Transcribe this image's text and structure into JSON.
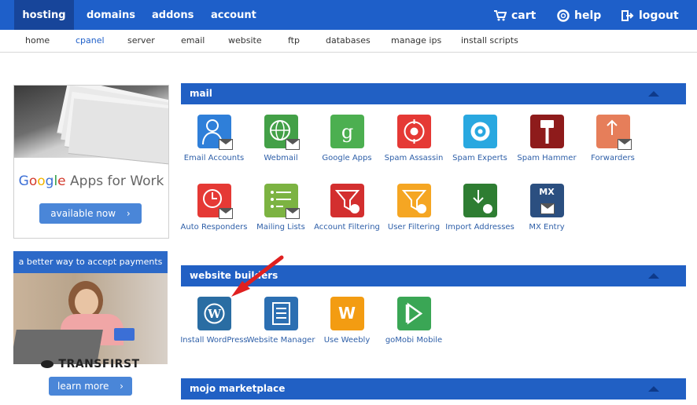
{
  "topnav": {
    "tabs": [
      {
        "label": "hosting"
      },
      {
        "label": "domains"
      },
      {
        "label": "addons"
      },
      {
        "label": "account"
      }
    ],
    "right": {
      "cart": "cart",
      "help": "help",
      "logout": "logout"
    }
  },
  "subnav": {
    "items": [
      {
        "label": "home"
      },
      {
        "label": "cpanel"
      },
      {
        "label": "server"
      },
      {
        "label": "email"
      },
      {
        "label": "website"
      },
      {
        "label": "ftp"
      },
      {
        "label": "databases"
      },
      {
        "label": "manage ips"
      },
      {
        "label": "install scripts"
      }
    ],
    "active": "cpanel"
  },
  "ads": {
    "google": {
      "brand_google": "Google",
      "brand_rest": "Apps for Work",
      "button": "available now"
    },
    "transfirst": {
      "header": "a better way to accept payments",
      "logo": "TRANSFIRST",
      "button": "learn more"
    }
  },
  "sections": {
    "mail": {
      "title": "mail",
      "apps": [
        {
          "label": "Email Accounts",
          "icon": "email-accounts-icon",
          "color": "#2f7fd9"
        },
        {
          "label": "Webmail",
          "icon": "webmail-icon",
          "color": "#43a047"
        },
        {
          "label": "Google Apps",
          "icon": "google-apps-icon",
          "color": "#4caf50"
        },
        {
          "label": "Spam Assassin",
          "icon": "spam-assassin-icon",
          "color": "#e53935"
        },
        {
          "label": "Spam Experts",
          "icon": "spam-experts-icon",
          "color": "#29a8e0"
        },
        {
          "label": "Spam Hammer",
          "icon": "spam-hammer-icon",
          "color": "#8e1b1b"
        },
        {
          "label": "Forwarders",
          "icon": "forwarders-icon",
          "color": "#e67e5a"
        },
        {
          "label": "Auto Responders",
          "icon": "auto-responders-icon",
          "color": "#e53935"
        },
        {
          "label": "Mailing Lists",
          "icon": "mailing-lists-icon",
          "color": "#7cb342"
        },
        {
          "label": "Account Filtering",
          "icon": "account-filtering-icon",
          "color": "#d32f2f"
        },
        {
          "label": "User Filtering",
          "icon": "user-filtering-icon",
          "color": "#f5a623"
        },
        {
          "label": "Import Addresses",
          "icon": "import-addresses-icon",
          "color": "#2e7d32"
        },
        {
          "label": "MX Entry",
          "icon": "mx-entry-icon",
          "color": "#2b4f80",
          "badge": "MX"
        }
      ]
    },
    "website_builders": {
      "title": "website builders",
      "apps": [
        {
          "label": "Install WordPress",
          "icon": "wordpress-icon",
          "color": "#2a6da3"
        },
        {
          "label": "Website Manager",
          "icon": "website-manager-icon",
          "color": "#2c6fb2"
        },
        {
          "label": "Use Weebly",
          "icon": "weebly-icon",
          "color": "#f39c12",
          "badge": "W"
        },
        {
          "label": "goMobi Mobile",
          "icon": "gomobi-icon",
          "color": "#3aa655"
        }
      ]
    },
    "mojo": {
      "title": "mojo marketplace"
    }
  }
}
